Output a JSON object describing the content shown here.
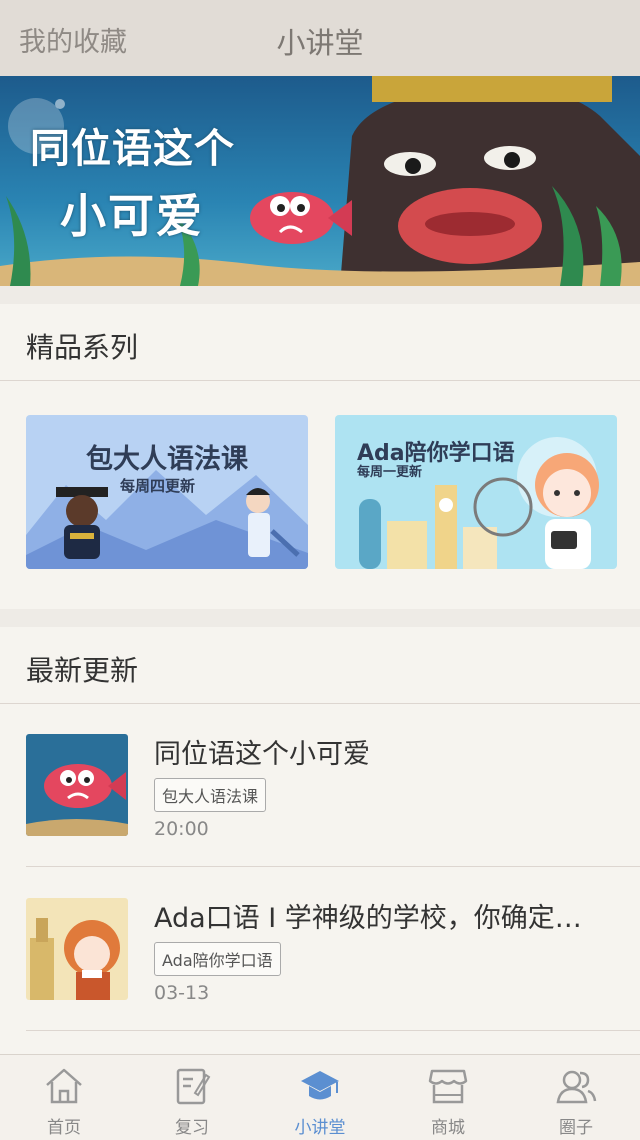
{
  "header": {
    "left_link": "我的收藏",
    "title": "小讲堂"
  },
  "banner": {
    "line1": "同位语这个",
    "line2": "小可爱"
  },
  "featured": {
    "section_title": "精品系列",
    "series": [
      {
        "title": "包大人语法课",
        "subtitle": "每周四更新"
      },
      {
        "title": "Ada陪你学口语",
        "subtitle": "每周一更新"
      }
    ]
  },
  "latest": {
    "section_title": "最新更新",
    "items": [
      {
        "title": "同位语这个小可爱",
        "tag": "包大人语法课",
        "time": "20:00"
      },
      {
        "title": "Ada口语 I 学神级的学校，你确定…",
        "tag": "Ada陪你学口语",
        "time": "03-13"
      }
    ]
  },
  "tabbar": {
    "tabs": [
      {
        "label": "首页",
        "icon": "home-icon"
      },
      {
        "label": "复习",
        "icon": "review-icon"
      },
      {
        "label": "小讲堂",
        "icon": "graduation-cap-icon",
        "active": true
      },
      {
        "label": "商城",
        "icon": "shop-icon"
      },
      {
        "label": "圈子",
        "icon": "people-icon"
      }
    ],
    "active_color": "#5b8fd1",
    "inactive_color": "#888888"
  }
}
